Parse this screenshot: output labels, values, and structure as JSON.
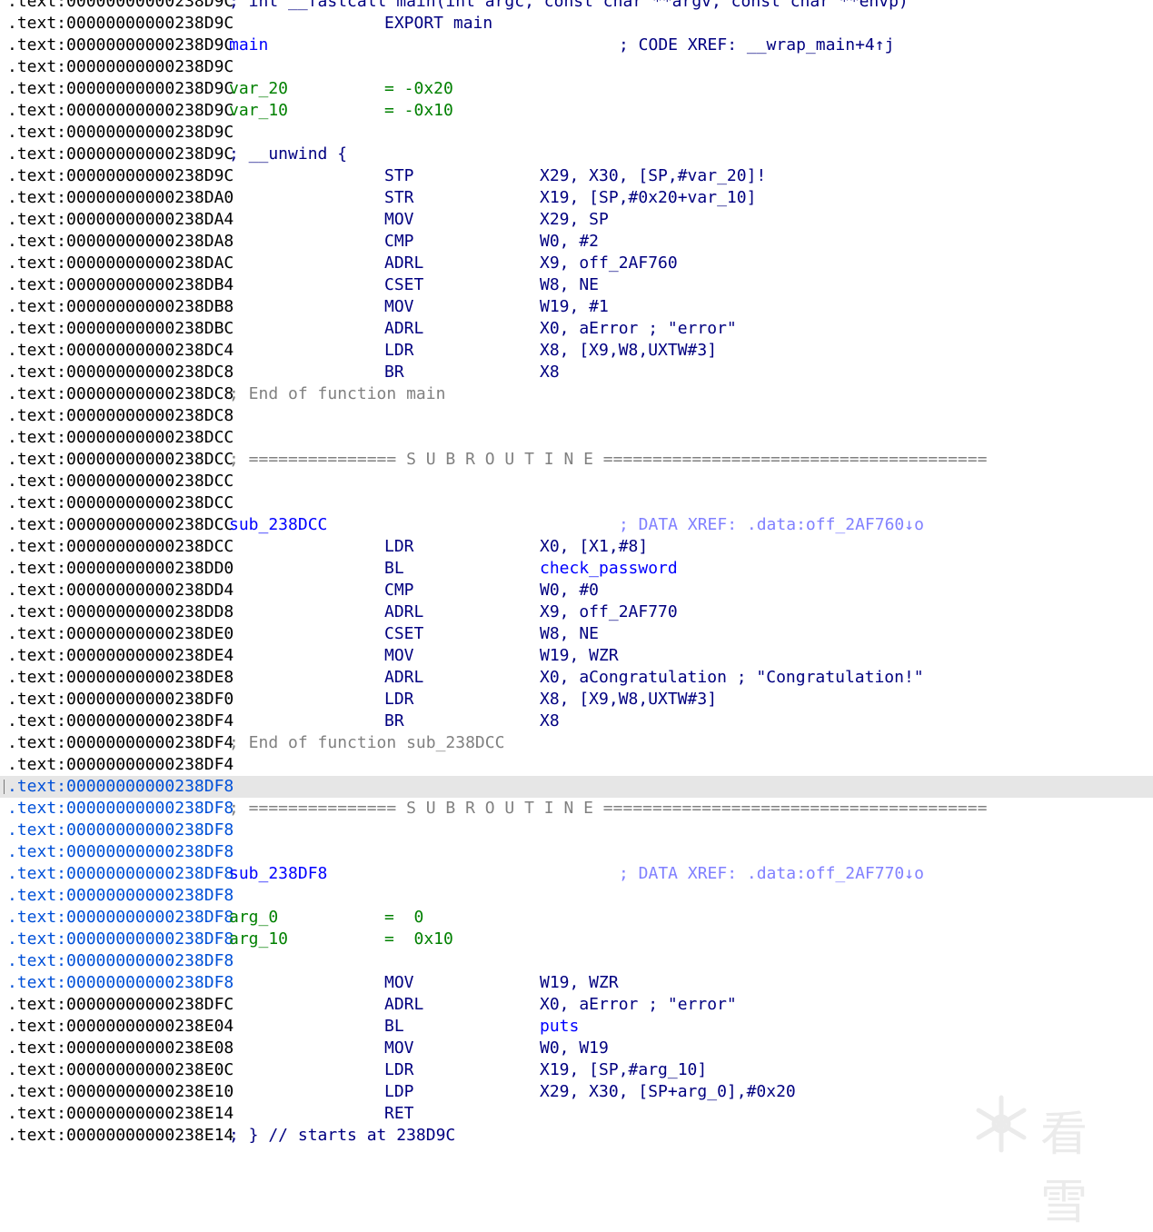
{
  "colors": {
    "normal": "#000000",
    "name": "#0000ff",
    "keyword": "#000080",
    "number": "#008000",
    "comment": "#808080",
    "xref": "#8080ff",
    "selected_address": "#0050d8",
    "highlight_bg": "#e6e6e6"
  },
  "watermark": {
    "text": "看雪",
    "icon": "snowflake-icon"
  },
  "lines": [
    {
      "addr": ".text:00000000000238D9C",
      "c1": "; int __fastcall main(int argc, const char **argv, const char **envp)",
      "c1s": "kw"
    },
    {
      "addr": ".text:00000000000238D9C",
      "c2": "EXPORT main",
      "c2s": "kw"
    },
    {
      "addr": ".text:00000000000238D9C",
      "c1": "main",
      "c1s": "blue",
      "c4": "; CODE XREF: __wrap_main+4↑j",
      "c4s": "kw"
    },
    {
      "addr": ".text:00000000000238D9C"
    },
    {
      "addr": ".text:00000000000238D9C",
      "c1": "var_20",
      "c1s": "green",
      "c2": "= -0x20",
      "c2s": "green"
    },
    {
      "addr": ".text:00000000000238D9C",
      "c1": "var_10",
      "c1s": "green",
      "c2": "= -0x10",
      "c2s": "green"
    },
    {
      "addr": ".text:00000000000238D9C"
    },
    {
      "addr": ".text:00000000000238D9C",
      "c1": "; __unwind {",
      "c1s": "kw"
    },
    {
      "addr": ".text:00000000000238D9C",
      "c2": "STP",
      "c2s": "kw",
      "c3": "X29, X30, [SP,#var_20]!",
      "c3s": "kw"
    },
    {
      "addr": ".text:00000000000238DA0",
      "c2": "STR",
      "c2s": "kw",
      "c3": "X19, [SP,#0x20+var_10]",
      "c3s": "kw"
    },
    {
      "addr": ".text:00000000000238DA4",
      "c2": "MOV",
      "c2s": "kw",
      "c3": "X29, SP",
      "c3s": "kw"
    },
    {
      "addr": ".text:00000000000238DA8",
      "c2": "CMP",
      "c2s": "kw",
      "c3": "W0, #2",
      "c3s": "kw"
    },
    {
      "addr": ".text:00000000000238DAC",
      "c2": "ADRL",
      "c2s": "kw",
      "c3": "X9, off_2AF760",
      "c3s": "kw"
    },
    {
      "addr": ".text:00000000000238DB4",
      "c2": "CSET",
      "c2s": "kw",
      "c3": "W8, NE",
      "c3s": "kw"
    },
    {
      "addr": ".text:00000000000238DB8",
      "c2": "MOV",
      "c2s": "kw",
      "c3": "W19, #1",
      "c3s": "kw"
    },
    {
      "addr": ".text:00000000000238DBC",
      "c2": "ADRL",
      "c2s": "kw",
      "c3": "X0, aError ; \"error\"",
      "c3s": "kw"
    },
    {
      "addr": ".text:00000000000238DC4",
      "c2": "LDR",
      "c2s": "kw",
      "c3": "X8, [X9,W8,UXTW#3]",
      "c3s": "kw"
    },
    {
      "addr": ".text:00000000000238DC8",
      "c2": "BR",
      "c2s": "kw",
      "c3": "X8",
      "c3s": "kw"
    },
    {
      "addr": ".text:00000000000238DC8",
      "c1": "; End of function main",
      "c1s": "gray"
    },
    {
      "addr": ".text:00000000000238DC8"
    },
    {
      "addr": ".text:00000000000238DCC"
    },
    {
      "addr": ".text:00000000000238DCC",
      "c1": "; =============== S U B R O U T I N E =======================================",
      "c1s": "gray"
    },
    {
      "addr": ".text:00000000000238DCC"
    },
    {
      "addr": ".text:00000000000238DCC"
    },
    {
      "addr": ".text:00000000000238DCC",
      "c1": "sub_238DCC",
      "c1s": "blue",
      "c4": "; DATA XREF: .data:off_2AF760↓o",
      "c4s": "xref"
    },
    {
      "addr": ".text:00000000000238DCC",
      "c2": "LDR",
      "c2s": "kw",
      "c3": "X0, [X1,#8]",
      "c3s": "kw"
    },
    {
      "addr": ".text:00000000000238DD0",
      "c2": "BL",
      "c2s": "kw",
      "c3": "check_password",
      "c3s": "blue"
    },
    {
      "addr": ".text:00000000000238DD4",
      "c2": "CMP",
      "c2s": "kw",
      "c3": "W0, #0",
      "c3s": "kw"
    },
    {
      "addr": ".text:00000000000238DD8",
      "c2": "ADRL",
      "c2s": "kw",
      "c3": "X9, off_2AF770",
      "c3s": "kw"
    },
    {
      "addr": ".text:00000000000238DE0",
      "c2": "CSET",
      "c2s": "kw",
      "c3": "W8, NE",
      "c3s": "kw"
    },
    {
      "addr": ".text:00000000000238DE4",
      "c2": "MOV",
      "c2s": "kw",
      "c3": "W19, WZR",
      "c3s": "kw"
    },
    {
      "addr": ".text:00000000000238DE8",
      "c2": "ADRL",
      "c2s": "kw",
      "c3": "X0, aCongratulation ; \"Congratulation!\"",
      "c3s": "kw"
    },
    {
      "addr": ".text:00000000000238DF0",
      "c2": "LDR",
      "c2s": "kw",
      "c3": "X8, [X9,W8,UXTW#3]",
      "c3s": "kw"
    },
    {
      "addr": ".text:00000000000238DF4",
      "c2": "BR",
      "c2s": "kw",
      "c3": "X8",
      "c3s": "kw"
    },
    {
      "addr": ".text:00000000000238DF4",
      "c1": "; End of function sub_238DCC",
      "c1s": "gray"
    },
    {
      "addr": ".text:00000000000238DF4"
    },
    {
      "addr": ".text:00000000000238DF8",
      "sel": true,
      "hl": true
    },
    {
      "addr": ".text:00000000000238DF8",
      "sel": true,
      "c1": "; =============== S U B R O U T I N E =======================================",
      "c1s": "gray"
    },
    {
      "addr": ".text:00000000000238DF8",
      "sel": true
    },
    {
      "addr": ".text:00000000000238DF8",
      "sel": true
    },
    {
      "addr": ".text:00000000000238DF8",
      "sel": true,
      "c1": "sub_238DF8",
      "c1s": "blue",
      "c4": "; DATA XREF: .data:off_2AF770↓o",
      "c4s": "xref"
    },
    {
      "addr": ".text:00000000000238DF8",
      "sel": true
    },
    {
      "addr": ".text:00000000000238DF8",
      "sel": true,
      "c1": "arg_0",
      "c1s": "green",
      "c2": "=  0",
      "c2s": "green"
    },
    {
      "addr": ".text:00000000000238DF8",
      "sel": true,
      "c1": "arg_10",
      "c1s": "green",
      "c2": "=  0x10",
      "c2s": "green"
    },
    {
      "addr": ".text:00000000000238DF8",
      "sel": true
    },
    {
      "addr": ".text:00000000000238DF8",
      "sel": true,
      "c2": "MOV",
      "c2s": "kw",
      "c3": "W19, WZR",
      "c3s": "kw"
    },
    {
      "addr": ".text:00000000000238DFC",
      "c2": "ADRL",
      "c2s": "kw",
      "c3": "X0, aError ; \"error\"",
      "c3s": "kw"
    },
    {
      "addr": ".text:00000000000238E04",
      "c2": "BL",
      "c2s": "kw",
      "c3": "puts",
      "c3s": "blue"
    },
    {
      "addr": ".text:00000000000238E08",
      "c2": "MOV",
      "c2s": "kw",
      "c3": "W0, W19",
      "c3s": "kw"
    },
    {
      "addr": ".text:00000000000238E0C",
      "c2": "LDR",
      "c2s": "kw",
      "c3": "X19, [SP,#arg_10]",
      "c3s": "kw"
    },
    {
      "addr": ".text:00000000000238E10",
      "c2": "LDP",
      "c2s": "kw",
      "c3": "X29, X30, [SP+arg_0],#0x20",
      "c3s": "kw"
    },
    {
      "addr": ".text:00000000000238E14",
      "c2": "RET",
      "c2s": "kw"
    },
    {
      "addr": ".text:00000000000238E14",
      "c1": "; } // starts at 238D9C",
      "c1s": "kw"
    }
  ]
}
